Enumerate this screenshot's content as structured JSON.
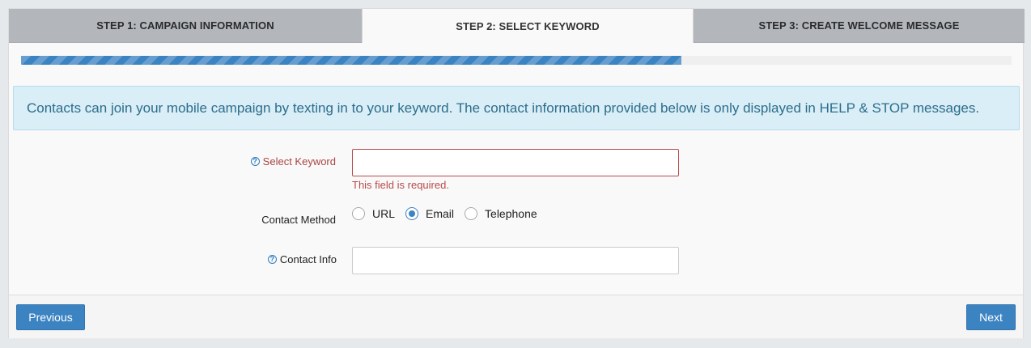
{
  "tabs": [
    {
      "label": "STEP 1: CAMPAIGN INFORMATION",
      "active": false
    },
    {
      "label": "STEP 2: SELECT KEYWORD",
      "active": true
    },
    {
      "label": "STEP 3: CREATE WELCOME MESSAGE",
      "active": false
    }
  ],
  "progress": {
    "percent": 66.7,
    "color": "#3c83c2"
  },
  "alert": {
    "text": "Contacts can join your mobile campaign by texting in to your keyword. The contact information provided below is only displayed in HELP & STOP messages."
  },
  "form": {
    "keyword": {
      "help_icon": "question-circle-icon",
      "label": "Select Keyword",
      "value": "",
      "error": "This field is required."
    },
    "contact_method": {
      "label": "Contact Method",
      "options": [
        "URL",
        "Email",
        "Telephone"
      ],
      "selected": "Email"
    },
    "contact_info": {
      "help_icon": "question-circle-icon",
      "label": "Contact Info",
      "value": ""
    }
  },
  "footer": {
    "previous_label": "Previous",
    "next_label": "Next"
  },
  "colors": {
    "primary": "#3c83c2",
    "error": "#a94442",
    "alert_bg": "#d9eef6"
  }
}
